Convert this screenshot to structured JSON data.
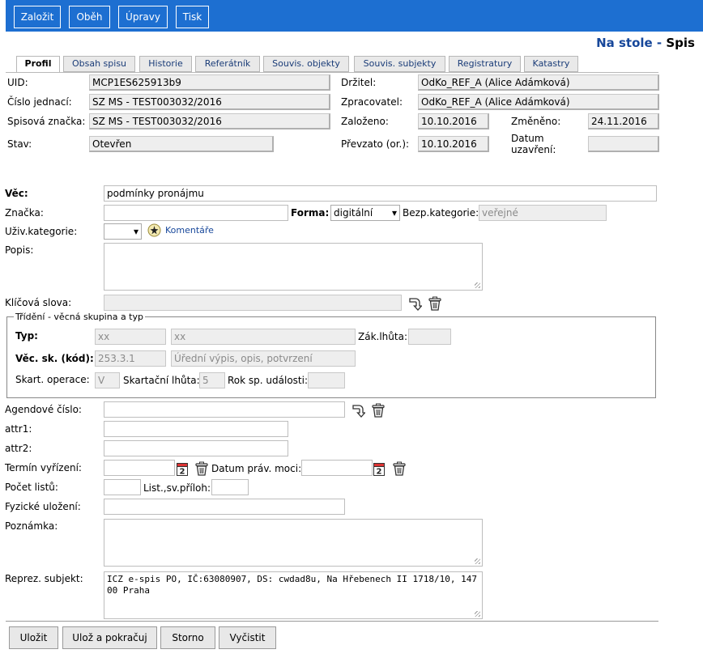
{
  "toolbar": {
    "buttons": [
      "Založit",
      "Oběh",
      "Úpravy",
      "Tisk"
    ]
  },
  "header": {
    "location": "Na stole",
    "separator": " - ",
    "title": "Spis"
  },
  "tabs": [
    "Profil",
    "Obsah spisu",
    "Historie",
    "Referátník",
    "Souvis. objekty",
    "Souvis. subjekty",
    "Registratury",
    "Katastry"
  ],
  "profile": {
    "uid_label": "UID:",
    "uid": "MCP1ES625913b9",
    "cj_label": "Číslo jednací:",
    "cj": "SZ MS - TEST003032/2016",
    "sz_label": "Spisová značka:",
    "sz": "SZ MS - TEST003032/2016",
    "stav_label": "Stav:",
    "stav": "Otevřen",
    "drzitel_label": "Držitel:",
    "drzitel": "OdKo_REF_A (Alice Adámková)",
    "zprac_label": "Zpracovatel:",
    "zprac": "OdKo_REF_A (Alice Adámková)",
    "zalozeno_label": "Založeno:",
    "zalozeno": "10.10.2016",
    "zmeneno_label": "Změněno:",
    "zmeneno": "24.11.2016",
    "prevzato_label": "Převzato (or.):",
    "prevzato": "10.10.2016",
    "uzavreni_label_1": "Datum",
    "uzavreni_label_2": "uzavření:",
    "uzavreni": ""
  },
  "form": {
    "vec_label": "Věc:",
    "vec": "podmínky pronájmu",
    "znacka_label": "Značka:",
    "znacka": "",
    "forma_label": "Forma:",
    "forma": "digitální",
    "bezp_label": "Bezp.kategorie:",
    "bezp": "veřejné",
    "uziv_label": "Uživ.kategorie:",
    "uziv": "",
    "komentare": "Komentáře",
    "popis_label": "Popis:",
    "popis": "",
    "klic_label": "Klíčová slova:",
    "klic": "",
    "agend_label": "Agendové číslo:",
    "agend": "",
    "attr1_label": "attr1:",
    "attr1": "",
    "attr2_label": "attr2:",
    "attr2": "",
    "termin_label": "Termín vyřízení:",
    "termin": "",
    "pravmoc_label": "Datum práv. moci:",
    "pravmoc": "",
    "listu_label": "Počet listů:",
    "listu": "",
    "priloh_label": "List.,sv.příloh:",
    "priloh": "",
    "fyz_label": "Fyzické uložení:",
    "fyz": "",
    "pozn_label": "Poznámka:",
    "pozn": "",
    "reprez_label": "Reprez. subjekt:",
    "reprez": "ICZ e-spis PO, IČ:63080907, DS: cwdad8u, Na Hřebenech II 1718/10, 147 00 Praha"
  },
  "trideni": {
    "legend": "Třídění - věcná skupina a typ",
    "typ_label": "Typ:",
    "typ_code": "xx",
    "typ_name": "xx",
    "zak_label": "Zák.lhůta:",
    "zak": "",
    "vsk_label": "Věc. sk. (kód):",
    "vsk_code": "253.3.1",
    "vsk_name": "Úřední výpis, opis, potvrzení",
    "skop_label": "Skart. operace:",
    "skop": "V",
    "sklh_label": "Skartační lhůta:",
    "sklh": "5",
    "rok_label": "Rok sp. události:",
    "rok": ""
  },
  "footer": {
    "buttons": [
      "Uložit",
      "Ulož a pokračuj",
      "Storno",
      "Vyčistit"
    ]
  },
  "calendar_day": "2"
}
